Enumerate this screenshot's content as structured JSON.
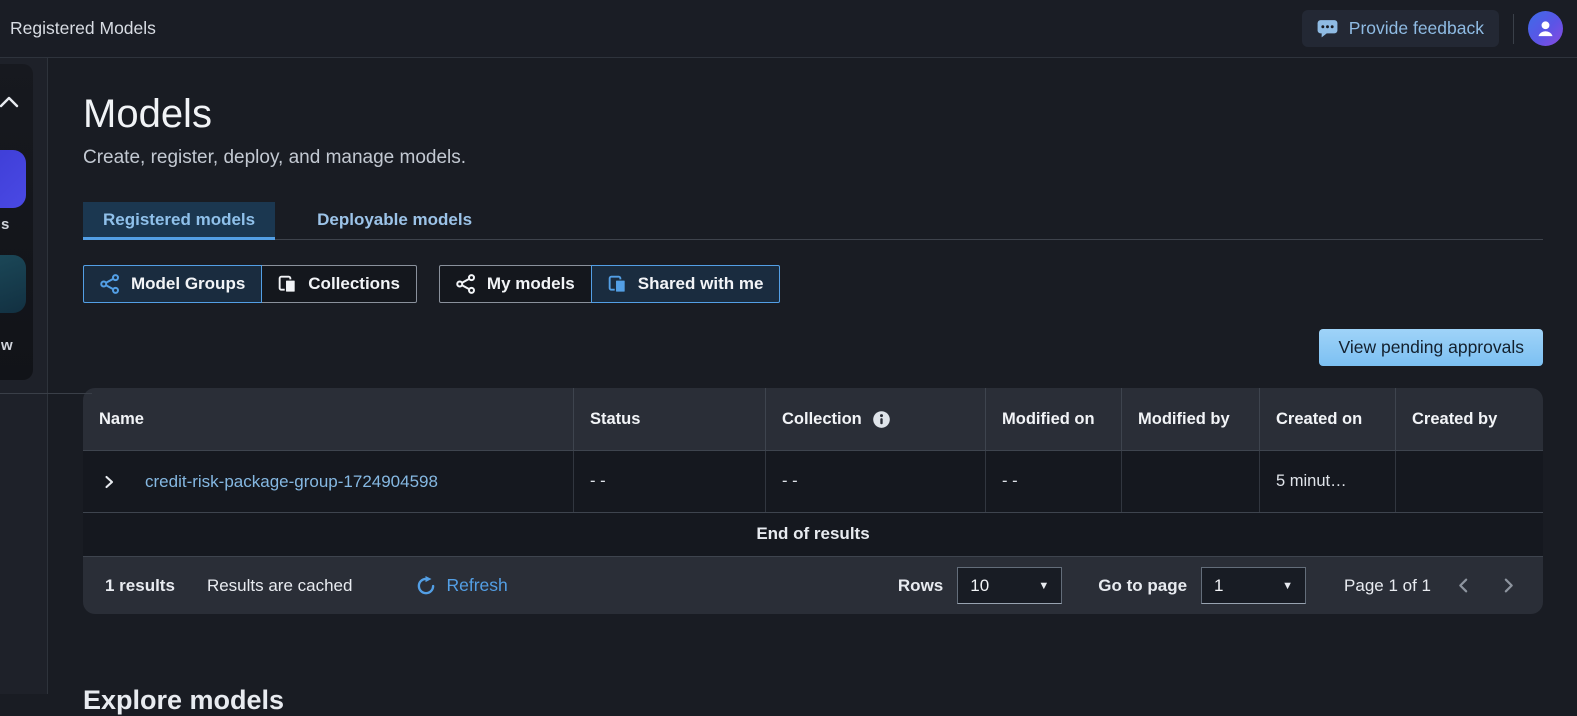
{
  "topbar": {
    "title": "Registered Models",
    "feedback_label": "Provide feedback"
  },
  "page": {
    "title": "Models",
    "subtitle": "Create, register, deploy, and manage models."
  },
  "tabs": [
    {
      "label": "Registered models",
      "active": true
    },
    {
      "label": "Deployable models",
      "active": false
    }
  ],
  "filters": {
    "group1": [
      {
        "label": "Model Groups",
        "selected": true
      },
      {
        "label": "Collections",
        "selected": false
      }
    ],
    "group2": [
      {
        "label": "My models",
        "selected": false
      },
      {
        "label": "Shared with me",
        "selected": true
      }
    ]
  },
  "actions": {
    "view_pending_approvals": "View pending approvals"
  },
  "table": {
    "columns": [
      "Name",
      "Status",
      "Collection",
      "Modified on",
      "Modified by",
      "Created on",
      "Created by"
    ],
    "rows": [
      {
        "name": "credit-risk-package-group-1724904598",
        "status": "- -",
        "collection": "- -",
        "modified_on": "- -",
        "modified_by": "",
        "created_on": "5 minut…",
        "created_by": ""
      }
    ],
    "end_of_results": "End of results"
  },
  "footer": {
    "results_count": "1 results",
    "cached_note": "Results are cached",
    "refresh_label": "Refresh",
    "rows_label": "Rows",
    "rows_value": "10",
    "goto_label": "Go to page",
    "goto_value": "1",
    "page_status": "Page 1 of 1"
  },
  "left_flyout": {
    "letter_fragment_1": "s",
    "letter_fragment_2": "w"
  },
  "clipped_heading": "Explore models",
  "colors": {
    "accent_blue": "#539fe5",
    "link_blue": "#85b8e2",
    "primary_button": "#8ac6f4",
    "header_bg": "#2a2e37",
    "row_bg": "#15181f",
    "page_bg": "#191c23",
    "flyout_tile_blue": "#4444dd",
    "flyout_tile_teal": "#1c4a5a"
  }
}
